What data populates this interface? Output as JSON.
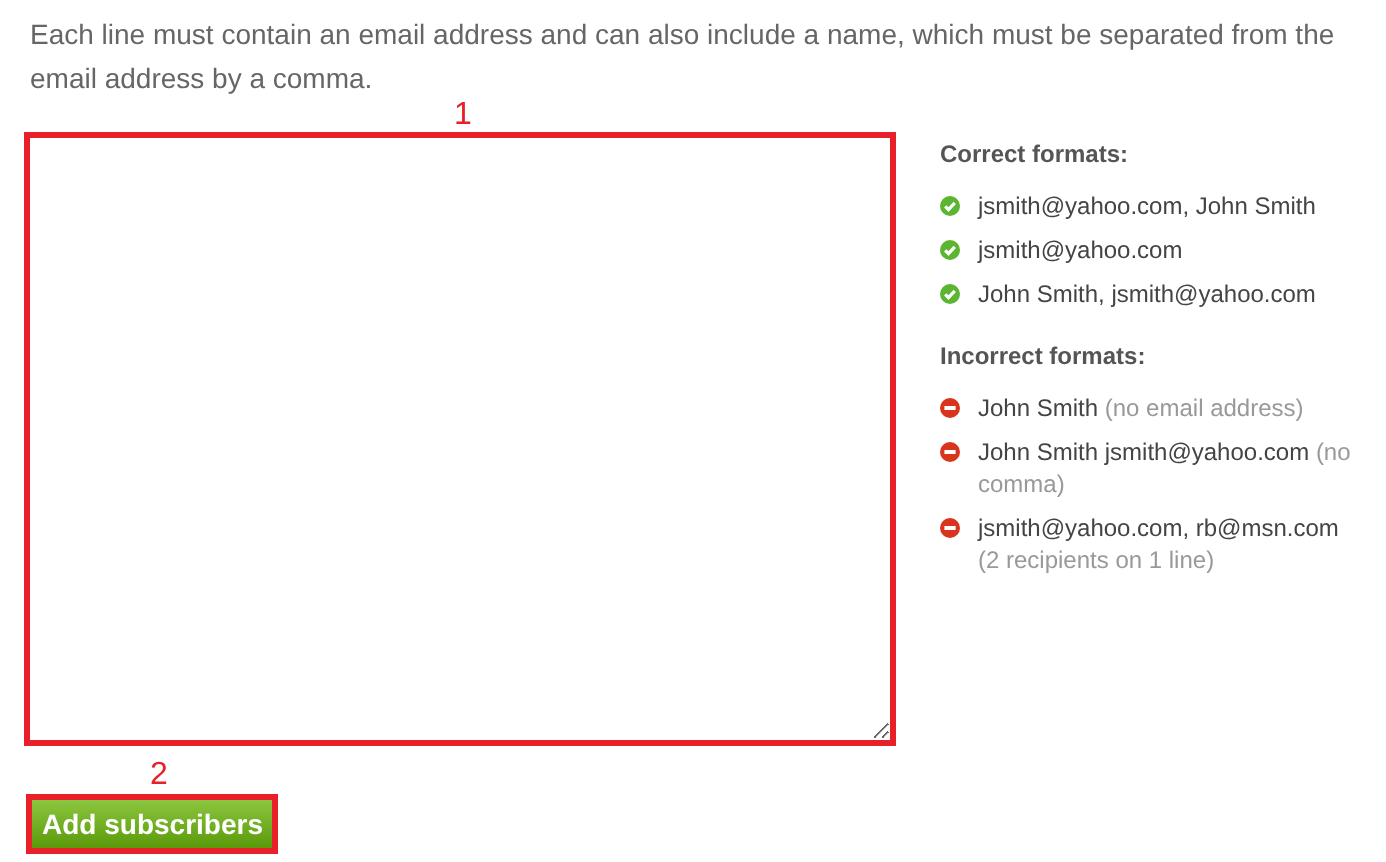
{
  "intro": "Each line must contain an email address and can also include a name, which must be separated from the email address by a comma.",
  "textarea": {
    "callout": "1"
  },
  "button": {
    "label": "Add subscribers",
    "callout": "2"
  },
  "groups": [
    {
      "title": "Correct formats:",
      "kind": "correct",
      "items": [
        {
          "text": "jsmith@yahoo.com, John Smith"
        },
        {
          "text": "jsmith@yahoo.com"
        },
        {
          "text": "John Smith, jsmith@yahoo.com"
        }
      ]
    },
    {
      "title": "Incorrect formats:",
      "kind": "incorrect",
      "items": [
        {
          "text": "John Smith",
          "note": "(no email address)"
        },
        {
          "text": "John Smith jsmith@yahoo.com",
          "note": "(no comma)"
        },
        {
          "text": "jsmith@yahoo.com, rb@msn.com",
          "note": "(2 recipients on 1 line)"
        }
      ]
    }
  ]
}
